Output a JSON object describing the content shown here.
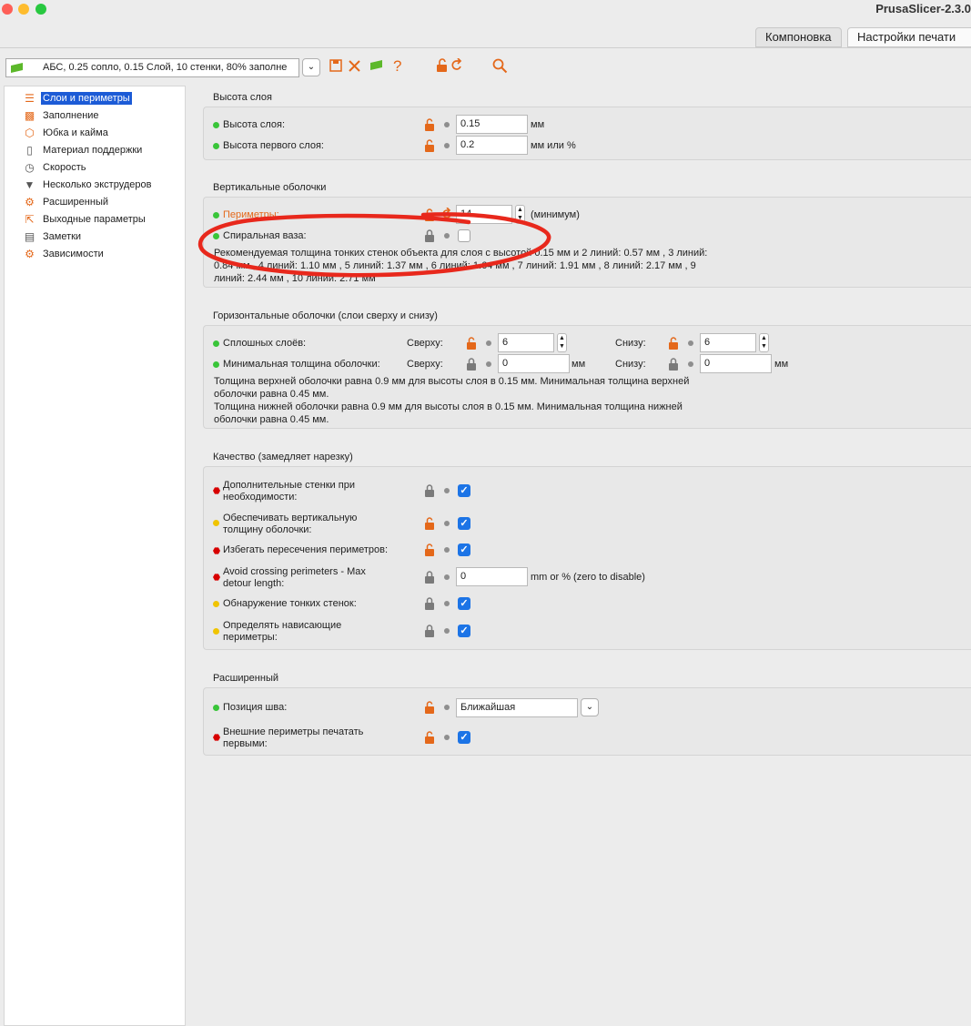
{
  "window": {
    "title": "PrusaSlicer-2.3.0"
  },
  "tabs": [
    {
      "label": "Компоновка"
    },
    {
      "label": "Настройки печати"
    }
  ],
  "toolbar": {
    "preset": "АБС, 0.25 сопло, 0.15 Слой, 10 стенки, 80% заполне",
    "help": "?"
  },
  "sidebar": {
    "items": [
      {
        "label": "Слои и периметры",
        "icon": "layers-icon"
      },
      {
        "label": "Заполнение",
        "icon": "infill-icon"
      },
      {
        "label": "Юбка и кайма",
        "icon": "skirt-icon"
      },
      {
        "label": "Материал поддержки",
        "icon": "support-icon"
      },
      {
        "label": "Скорость",
        "icon": "speed-icon"
      },
      {
        "label": "Несколько экструдеров",
        "icon": "extruders-icon"
      },
      {
        "label": "Расширенный",
        "icon": "advanced-icon"
      },
      {
        "label": "Выходные параметры",
        "icon": "output-icon"
      },
      {
        "label": "Заметки",
        "icon": "notes-icon"
      },
      {
        "label": "Зависимости",
        "icon": "dependencies-icon"
      }
    ]
  },
  "layer_height": {
    "title": "Высота слоя",
    "rows": [
      {
        "label": "Высота слоя:",
        "value": "0.15",
        "unit": "мм"
      },
      {
        "label": "Высота первого слоя:",
        "value": "0.2",
        "unit": "мм или %"
      }
    ]
  },
  "vertical_shells": {
    "title": "Вертикальные оболочки",
    "perimeters": {
      "label": "Периметры:",
      "value": "14",
      "unit": "(минимум)"
    },
    "spiral_vase": {
      "label": "Спиральная ваза:",
      "checked": false
    },
    "note": [
      "Рекомендуемая толщина тонких стенок объекта для слоя с высотой 0.15 мм и 2 линий: 0.57 мм , 3 линий:",
      "0.84 мм , 4 линий: 1.10 мм , 5 линий: 1.37 мм , 6 линий: 1.64 мм , 7 линий: 1.91 мм , 8 линий: 2.17 мм , 9",
      "линий: 2.44 мм , 10 линий: 2.71 мм"
    ]
  },
  "horizontal_shells": {
    "title": "Горизонтальные оболочки (слои сверху и снизу)",
    "solid_layers": {
      "label": "Сплошных слоёв:",
      "top_label": "Сверху:",
      "top": "6",
      "bottom_label": "Снизу:",
      "bottom": "6"
    },
    "min_thickness": {
      "label": "Минимальная толщина оболочки:",
      "top_label": "Сверху:",
      "top": "0",
      "top_unit": "мм",
      "bottom_label": "Снизу:",
      "bottom": "0",
      "bottom_unit": "мм"
    },
    "note": [
      "Толщина верхней оболочки равна 0.9 мм для высоты слоя в 0.15 мм. Минимальная толщина верхней",
      "оболочки равна 0.45 мм.",
      "Толщина нижней оболочки равна 0.9 мм для высоты слоя в 0.15 мм. Минимальная толщина нижней",
      "оболочки равна 0.45 мм."
    ]
  },
  "quality": {
    "title": "Качество (замедляет нарезку)",
    "rows": [
      {
        "label1": "Дополнительные стенки при",
        "label2": "необходимости:",
        "checked": true
      },
      {
        "label1": "Обеспечивать вертикальную",
        "label2": "толщину оболочки:",
        "checked": true
      },
      {
        "label1": "Избегать пересечения периметров:",
        "checked": true
      },
      {
        "label1": "Avoid crossing perimeters - Max",
        "label2": "detour length:",
        "value": "0",
        "unit": "mm or % (zero to disable)"
      },
      {
        "label1": "Обнаружение тонких стенок:",
        "checked": true
      },
      {
        "label1": "Определять нависающие",
        "label2": "периметры:",
        "checked": true
      }
    ]
  },
  "advanced": {
    "title": "Расширенный",
    "seam": {
      "label": "Позиция шва:",
      "value": "Ближайшая"
    },
    "external_first": {
      "label1": "Внешние периметры печатать",
      "label2": "первыми:",
      "checked": true
    }
  },
  "colors": {
    "accent": "#e4681a",
    "selection": "#1c5bd6",
    "checkbox": "#1c74e6",
    "annotation": "#e8281c"
  }
}
